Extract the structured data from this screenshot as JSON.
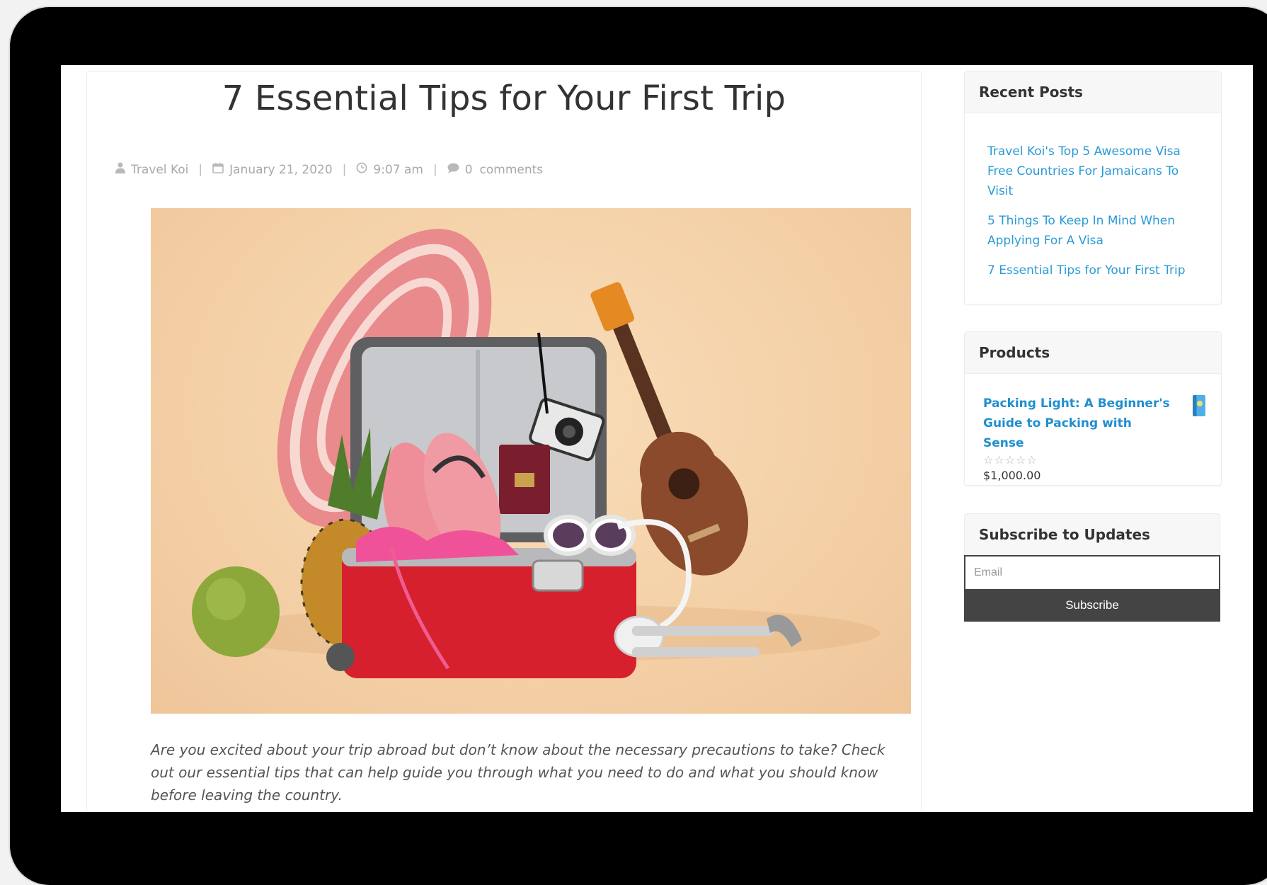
{
  "post": {
    "title": "7 Essential Tips for Your First Trip",
    "author": "Travel Koi",
    "date": "January 21, 2020",
    "time": "9:07 am",
    "comment_count": "0",
    "comment_label": "comments",
    "intro": "Are you excited about your trip abroad but don’t know about the necessary precautions to take? Check out our essential tips that can help guide you through what you need to do and what you should know before leaving the country."
  },
  "icons": {
    "author": "user-icon",
    "date": "calendar-icon",
    "time": "clock-icon",
    "comments": "comment-icon",
    "product": "book-icon"
  },
  "sidebar": {
    "recent_posts": {
      "title": "Recent Posts",
      "items": [
        "Travel Koi's Top 5 Awesome Visa Free Countries For Jamaicans To Visit",
        "5 Things To Keep In Mind When Applying For A Visa",
        "7 Essential Tips for Your First Trip"
      ]
    },
    "products": {
      "title": "Products",
      "items": [
        {
          "name": "Packing Light: A Beginner's Guide to Packing with Sense",
          "rating": 0,
          "rating_max": 5,
          "price": "$1,000.00"
        }
      ]
    },
    "subscribe": {
      "title": "Subscribe to Updates",
      "email_placeholder": "Email",
      "button_label": "Subscribe"
    }
  },
  "colors": {
    "link": "#2a9bd6",
    "button_bg": "#444444",
    "frame": "#000000"
  }
}
